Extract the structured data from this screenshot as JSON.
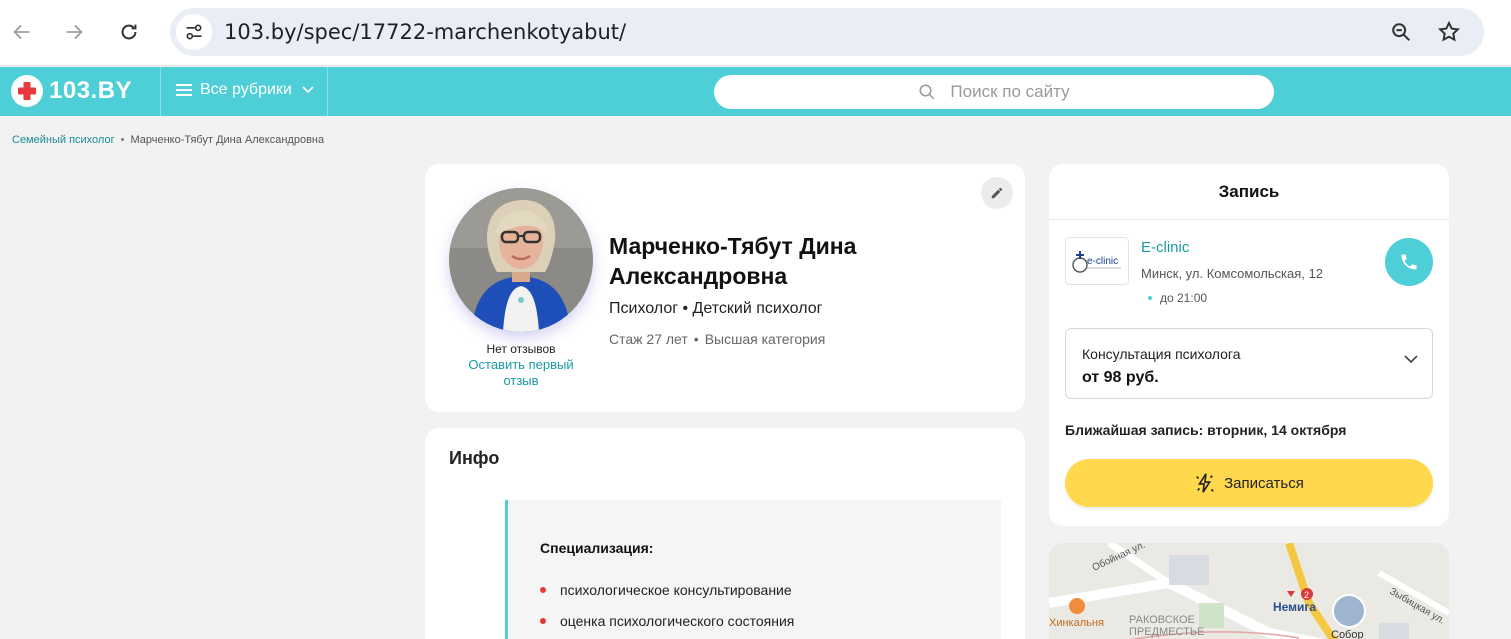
{
  "browser": {
    "url": "103.by/spec/17722-marchenkotyabut/",
    "icons": [
      "back-icon",
      "forward-icon",
      "reload-icon",
      "site-settings-icon",
      "zoom-icon",
      "bookmark-star-icon"
    ]
  },
  "header": {
    "logo_text": "103.BY",
    "rubrics_label": "Все рубрики",
    "search_placeholder": "Поиск по сайту",
    "brand_color": "#4ecfd7"
  },
  "breadcrumb": {
    "parent": "Семейный психолог",
    "current": "Марченко-Тябут Дина Александровна"
  },
  "profile": {
    "name": "Марченко-Тябут Дина Александровна",
    "specialties": "Психолог • Детский психолог",
    "experience": "Стаж 27 лет",
    "category": "Высшая категория",
    "separator": "•",
    "no_reviews": "Нет отзывов",
    "leave_review": "Оставить первый отзыв"
  },
  "info": {
    "title": "Инфо",
    "subtitle": "Специализация:",
    "items": [
      "психологическое консультирование",
      "оценка психологического состояния"
    ]
  },
  "booking": {
    "title": "Запись",
    "clinic_name": "E-clinic",
    "clinic_address": "Минск, ул. Комсомольская, 12",
    "clinic_hours": "до 21:00",
    "service_name": "Консультация психолога",
    "service_price": "от 98 руб.",
    "nearest": "Ближайшая запись: вторник, 14 октября",
    "book_label": "Записаться",
    "book_color": "#ffd84d"
  },
  "map": {
    "labels": {
      "street1": "Обойная ул.",
      "street2": "Зыбицкая ул.",
      "metro": "Немига",
      "metro_badge": "2",
      "place1": "Хинкальня",
      "place2": "РАКОВСКОЕ",
      "place3": "ПРЕДМЕСТЬЕ",
      "place4": "Собор"
    }
  }
}
